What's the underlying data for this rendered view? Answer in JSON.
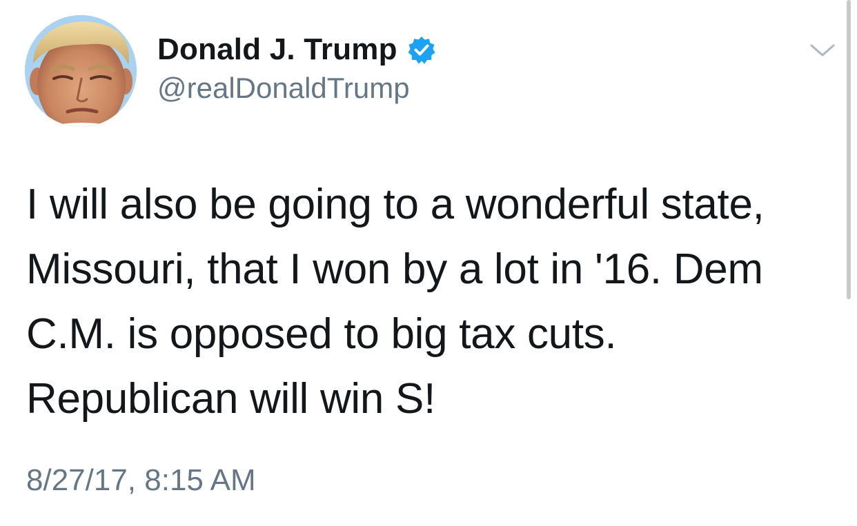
{
  "author": {
    "display_name": "Donald J. Trump",
    "handle": "@realDonaldTrump",
    "verified": true,
    "verified_icon": "verified-badge-icon",
    "avatar_icon": "profile-photo"
  },
  "tweet": {
    "lines": [
      "I will also be going to a wonderful state,",
      "Missouri, that I won by a lot in '16. Dem",
      "C.M. is opposed to big tax cuts.",
      "Republican will win S!"
    ],
    "timestamp": "8/27/17, 8:15 AM"
  },
  "menu": {
    "icon": "chevron-down-icon"
  },
  "colors": {
    "text": "#14171a",
    "secondary": "#657786",
    "verified_blue": "#1da1f2",
    "chevron": "#aab8c2"
  }
}
